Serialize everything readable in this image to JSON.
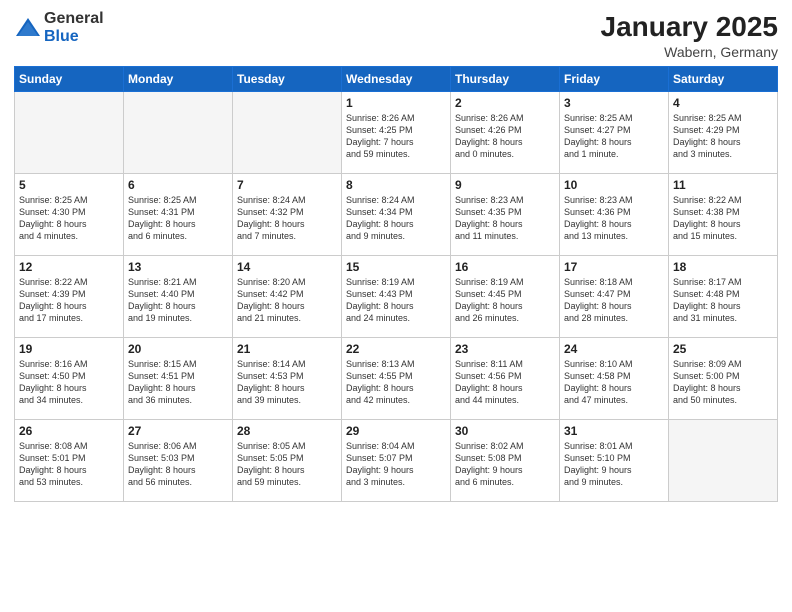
{
  "logo": {
    "general": "General",
    "blue": "Blue"
  },
  "header": {
    "month_year": "January 2025",
    "location": "Wabern, Germany"
  },
  "weekdays": [
    "Sunday",
    "Monday",
    "Tuesday",
    "Wednesday",
    "Thursday",
    "Friday",
    "Saturday"
  ],
  "weeks": [
    [
      {
        "day": "",
        "info": ""
      },
      {
        "day": "",
        "info": ""
      },
      {
        "day": "",
        "info": ""
      },
      {
        "day": "1",
        "info": "Sunrise: 8:26 AM\nSunset: 4:25 PM\nDaylight: 7 hours\nand 59 minutes."
      },
      {
        "day": "2",
        "info": "Sunrise: 8:26 AM\nSunset: 4:26 PM\nDaylight: 8 hours\nand 0 minutes."
      },
      {
        "day": "3",
        "info": "Sunrise: 8:25 AM\nSunset: 4:27 PM\nDaylight: 8 hours\nand 1 minute."
      },
      {
        "day": "4",
        "info": "Sunrise: 8:25 AM\nSunset: 4:29 PM\nDaylight: 8 hours\nand 3 minutes."
      }
    ],
    [
      {
        "day": "5",
        "info": "Sunrise: 8:25 AM\nSunset: 4:30 PM\nDaylight: 8 hours\nand 4 minutes."
      },
      {
        "day": "6",
        "info": "Sunrise: 8:25 AM\nSunset: 4:31 PM\nDaylight: 8 hours\nand 6 minutes."
      },
      {
        "day": "7",
        "info": "Sunrise: 8:24 AM\nSunset: 4:32 PM\nDaylight: 8 hours\nand 7 minutes."
      },
      {
        "day": "8",
        "info": "Sunrise: 8:24 AM\nSunset: 4:34 PM\nDaylight: 8 hours\nand 9 minutes."
      },
      {
        "day": "9",
        "info": "Sunrise: 8:23 AM\nSunset: 4:35 PM\nDaylight: 8 hours\nand 11 minutes."
      },
      {
        "day": "10",
        "info": "Sunrise: 8:23 AM\nSunset: 4:36 PM\nDaylight: 8 hours\nand 13 minutes."
      },
      {
        "day": "11",
        "info": "Sunrise: 8:22 AM\nSunset: 4:38 PM\nDaylight: 8 hours\nand 15 minutes."
      }
    ],
    [
      {
        "day": "12",
        "info": "Sunrise: 8:22 AM\nSunset: 4:39 PM\nDaylight: 8 hours\nand 17 minutes."
      },
      {
        "day": "13",
        "info": "Sunrise: 8:21 AM\nSunset: 4:40 PM\nDaylight: 8 hours\nand 19 minutes."
      },
      {
        "day": "14",
        "info": "Sunrise: 8:20 AM\nSunset: 4:42 PM\nDaylight: 8 hours\nand 21 minutes."
      },
      {
        "day": "15",
        "info": "Sunrise: 8:19 AM\nSunset: 4:43 PM\nDaylight: 8 hours\nand 24 minutes."
      },
      {
        "day": "16",
        "info": "Sunrise: 8:19 AM\nSunset: 4:45 PM\nDaylight: 8 hours\nand 26 minutes."
      },
      {
        "day": "17",
        "info": "Sunrise: 8:18 AM\nSunset: 4:47 PM\nDaylight: 8 hours\nand 28 minutes."
      },
      {
        "day": "18",
        "info": "Sunrise: 8:17 AM\nSunset: 4:48 PM\nDaylight: 8 hours\nand 31 minutes."
      }
    ],
    [
      {
        "day": "19",
        "info": "Sunrise: 8:16 AM\nSunset: 4:50 PM\nDaylight: 8 hours\nand 34 minutes."
      },
      {
        "day": "20",
        "info": "Sunrise: 8:15 AM\nSunset: 4:51 PM\nDaylight: 8 hours\nand 36 minutes."
      },
      {
        "day": "21",
        "info": "Sunrise: 8:14 AM\nSunset: 4:53 PM\nDaylight: 8 hours\nand 39 minutes."
      },
      {
        "day": "22",
        "info": "Sunrise: 8:13 AM\nSunset: 4:55 PM\nDaylight: 8 hours\nand 42 minutes."
      },
      {
        "day": "23",
        "info": "Sunrise: 8:11 AM\nSunset: 4:56 PM\nDaylight: 8 hours\nand 44 minutes."
      },
      {
        "day": "24",
        "info": "Sunrise: 8:10 AM\nSunset: 4:58 PM\nDaylight: 8 hours\nand 47 minutes."
      },
      {
        "day": "25",
        "info": "Sunrise: 8:09 AM\nSunset: 5:00 PM\nDaylight: 8 hours\nand 50 minutes."
      }
    ],
    [
      {
        "day": "26",
        "info": "Sunrise: 8:08 AM\nSunset: 5:01 PM\nDaylight: 8 hours\nand 53 minutes."
      },
      {
        "day": "27",
        "info": "Sunrise: 8:06 AM\nSunset: 5:03 PM\nDaylight: 8 hours\nand 56 minutes."
      },
      {
        "day": "28",
        "info": "Sunrise: 8:05 AM\nSunset: 5:05 PM\nDaylight: 8 hours\nand 59 minutes."
      },
      {
        "day": "29",
        "info": "Sunrise: 8:04 AM\nSunset: 5:07 PM\nDaylight: 9 hours\nand 3 minutes."
      },
      {
        "day": "30",
        "info": "Sunrise: 8:02 AM\nSunset: 5:08 PM\nDaylight: 9 hours\nand 6 minutes."
      },
      {
        "day": "31",
        "info": "Sunrise: 8:01 AM\nSunset: 5:10 PM\nDaylight: 9 hours\nand 9 minutes."
      },
      {
        "day": "",
        "info": ""
      }
    ]
  ]
}
